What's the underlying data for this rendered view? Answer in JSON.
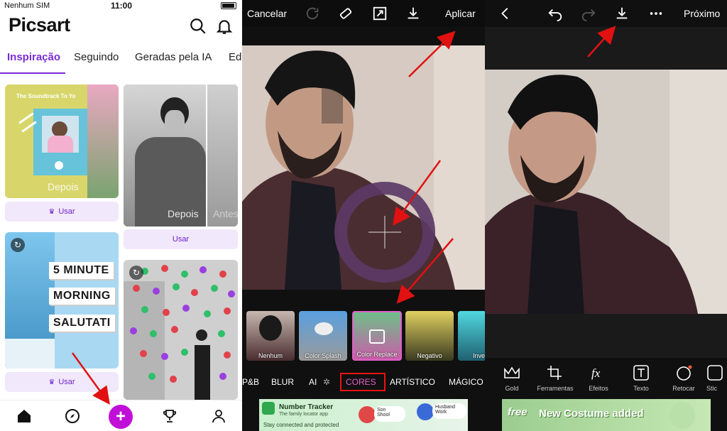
{
  "p1": {
    "status": {
      "carrier": "Nenhum SIM",
      "time": "11:00"
    },
    "logo": "Picsart",
    "tabs": [
      "Inspiração",
      "Seguindo",
      "Geradas pela IA",
      "Edi"
    ],
    "cards": {
      "card1_title": "The Soundtrack To Yo",
      "card1_overlay": "Depois",
      "card2_overlay": "Depois",
      "card2_after": "Antes",
      "use_label": "Usar",
      "lines": [
        "5 MINUTE",
        "MORNING",
        "SALUTATI"
      ]
    }
  },
  "p2": {
    "cancel": "Cancelar",
    "apply": "Aplicar",
    "thumbs": [
      "Nenhum",
      "Color Splash",
      "Color Replace",
      "Negativo",
      "Inve"
    ],
    "cats": [
      "P&B",
      "BLUR",
      "AI",
      "CORES",
      "ARTÍSTICO",
      "MÁGICO"
    ],
    "ad": {
      "title": "Number Tracker",
      "subtitle": "The family locator app",
      "tagline": "Stay connected and protected",
      "tag1_title": "Son",
      "tag1_sub": "Shool",
      "tag2_title": "Husband",
      "tag2_sub": "Work"
    }
  },
  "p3": {
    "next": "Próximo",
    "tools": [
      "Gold",
      "Ferramentas",
      "Efeitos",
      "Texto",
      "Retocar",
      "Stic"
    ],
    "ad": "New Costume added",
    "ad_free": "free"
  },
  "colors": {
    "accent": "#7a2cd8",
    "plus": "#c010d8",
    "arrow": "#e11111",
    "highlight": "#e11111"
  }
}
